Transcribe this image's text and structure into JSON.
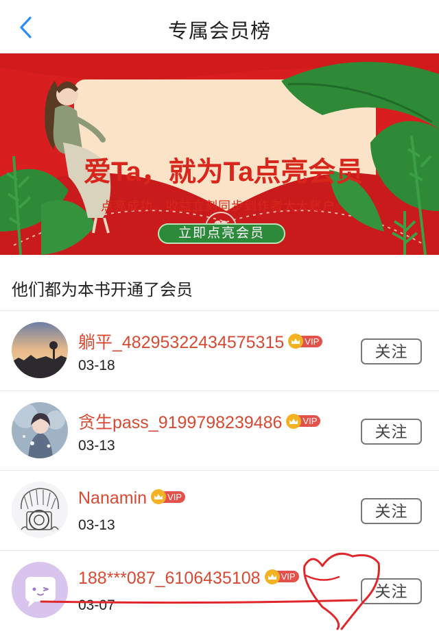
{
  "header": {
    "title": "专属会员榜"
  },
  "banner": {
    "headline": "爱Ta，就为Ta点亮会员",
    "subtitle": "点亮成功，收益立刻同步到作者大大账户",
    "cta_label": "立即点亮会员"
  },
  "section": {
    "title": "他们都为本书开通了会员"
  },
  "members": [
    {
      "name": "躺平_48295322434575315",
      "date": "03-18",
      "vip": "VIP",
      "follow_label": "关注"
    },
    {
      "name": "贪生pass_9199798239486",
      "date": "03-13",
      "vip": "VIP",
      "follow_label": "关注"
    },
    {
      "name": "Nanamin",
      "date": "03-13",
      "vip": "VIP",
      "follow_label": "关注"
    },
    {
      "name": "188***087_6106435108",
      "date": "03-07",
      "vip": "VIP",
      "follow_label": "关注"
    }
  ],
  "colors": {
    "accent_red": "#d64a33",
    "banner_red": "#d81e1e",
    "cta_green": "#2d8a3a",
    "back_blue": "#2c8cf4"
  }
}
